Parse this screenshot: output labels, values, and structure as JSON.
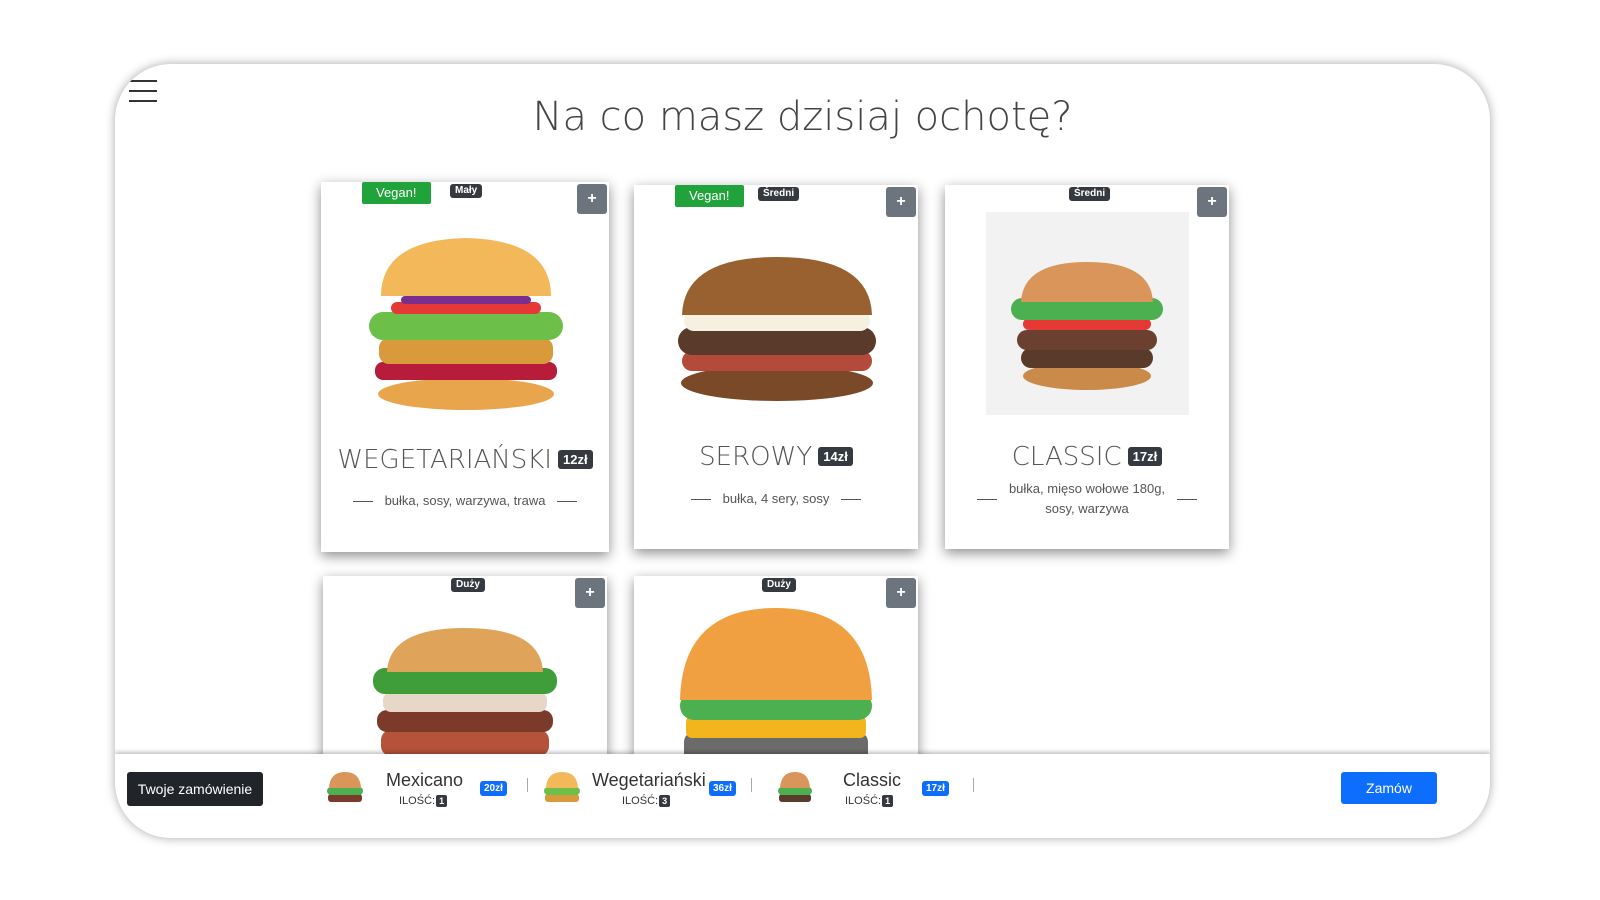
{
  "header": {
    "menu_icon": "hamburger-menu-icon",
    "title": "Na co masz dzisiaj ochotę?"
  },
  "cards": [
    {
      "vegan": "Vegan!",
      "size": "Mały",
      "add": "+",
      "name": "WEGETARIAŃSKI",
      "price": "12zł",
      "desc": "bułka, sosy, warzywa, trawa"
    },
    {
      "vegan": "Vegan!",
      "size": "Średni",
      "add": "+",
      "name": "SEROWY",
      "price": "14zł",
      "desc": "bułka, 4 sery, sosy"
    },
    {
      "size": "Średni",
      "add": "+",
      "name": "CLASSIC",
      "price": "17zł",
      "desc_line1": "bułka, mięso wołowe 180g,",
      "desc_line2": "sosy, warzywa"
    },
    {
      "size": "Duży",
      "add": "+"
    },
    {
      "size": "Duży",
      "add": "+"
    }
  ],
  "order": {
    "label": "Twoje zamówienie",
    "qty_label": "ILOŚĆ:",
    "items": [
      {
        "name": "Mexicano",
        "qty": "1",
        "price": "20zł"
      },
      {
        "name": "Wegetariański",
        "qty": "3",
        "price": "36zł"
      },
      {
        "name": "Classic",
        "qty": "1",
        "price": "17zł"
      }
    ],
    "submit": "Zamów"
  },
  "colors": {
    "vegan_badge": "#1fa33a",
    "dark_badge": "#343a40",
    "add_button": "#6c757d",
    "primary": "#0d6efd"
  }
}
